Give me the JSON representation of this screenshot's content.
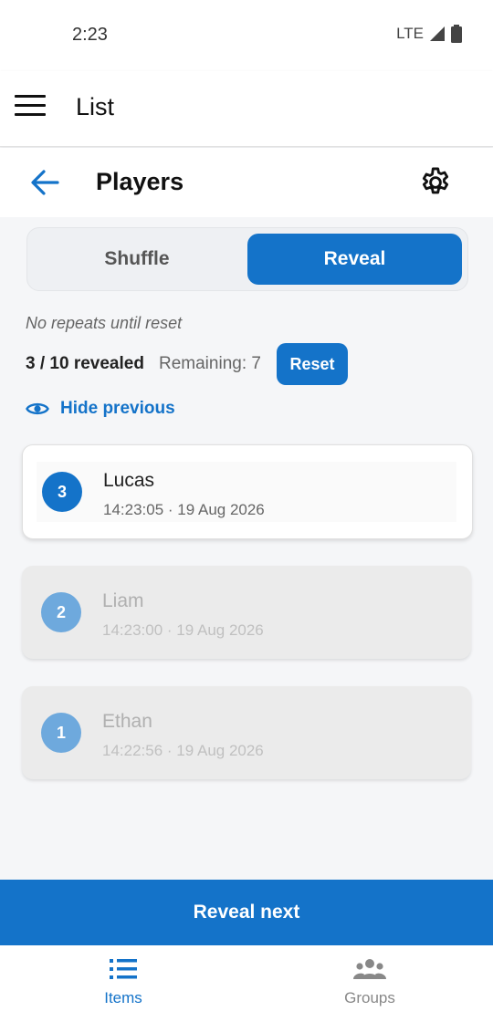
{
  "status_bar": {
    "time": "2:23",
    "network": "LTE"
  },
  "app_bar": {
    "title": "List"
  },
  "sub_header": {
    "title": "Players"
  },
  "mode_toggle": {
    "shuffle_label": "Shuffle",
    "reveal_label": "Reveal",
    "selected": "Reveal"
  },
  "info": {
    "note": "No repeats until reset",
    "revealed": "3 / 10 revealed",
    "remaining": "Remaining: 7",
    "reset_label": "Reset",
    "hide_previous_label": "Hide previous"
  },
  "reveals": [
    {
      "number": "3",
      "name": "Lucas",
      "time": "14:23:05 · 19 Aug 2026",
      "current": true
    },
    {
      "number": "2",
      "name": "Liam",
      "time": "14:23:00 · 19 Aug 2026",
      "current": false
    },
    {
      "number": "1",
      "name": "Ethan",
      "time": "14:22:56 · 19 Aug 2026",
      "current": false
    }
  ],
  "primary_action": {
    "label": "Reveal next"
  },
  "bottom_nav": {
    "items": [
      {
        "label": "Items",
        "icon": "list-icon",
        "active": true
      },
      {
        "label": "Groups",
        "icon": "groups-icon",
        "active": false
      }
    ]
  },
  "colors": {
    "accent": "#1473c9",
    "badge_dim": "#6ea9dd",
    "card_dim": "#ebebeb"
  }
}
